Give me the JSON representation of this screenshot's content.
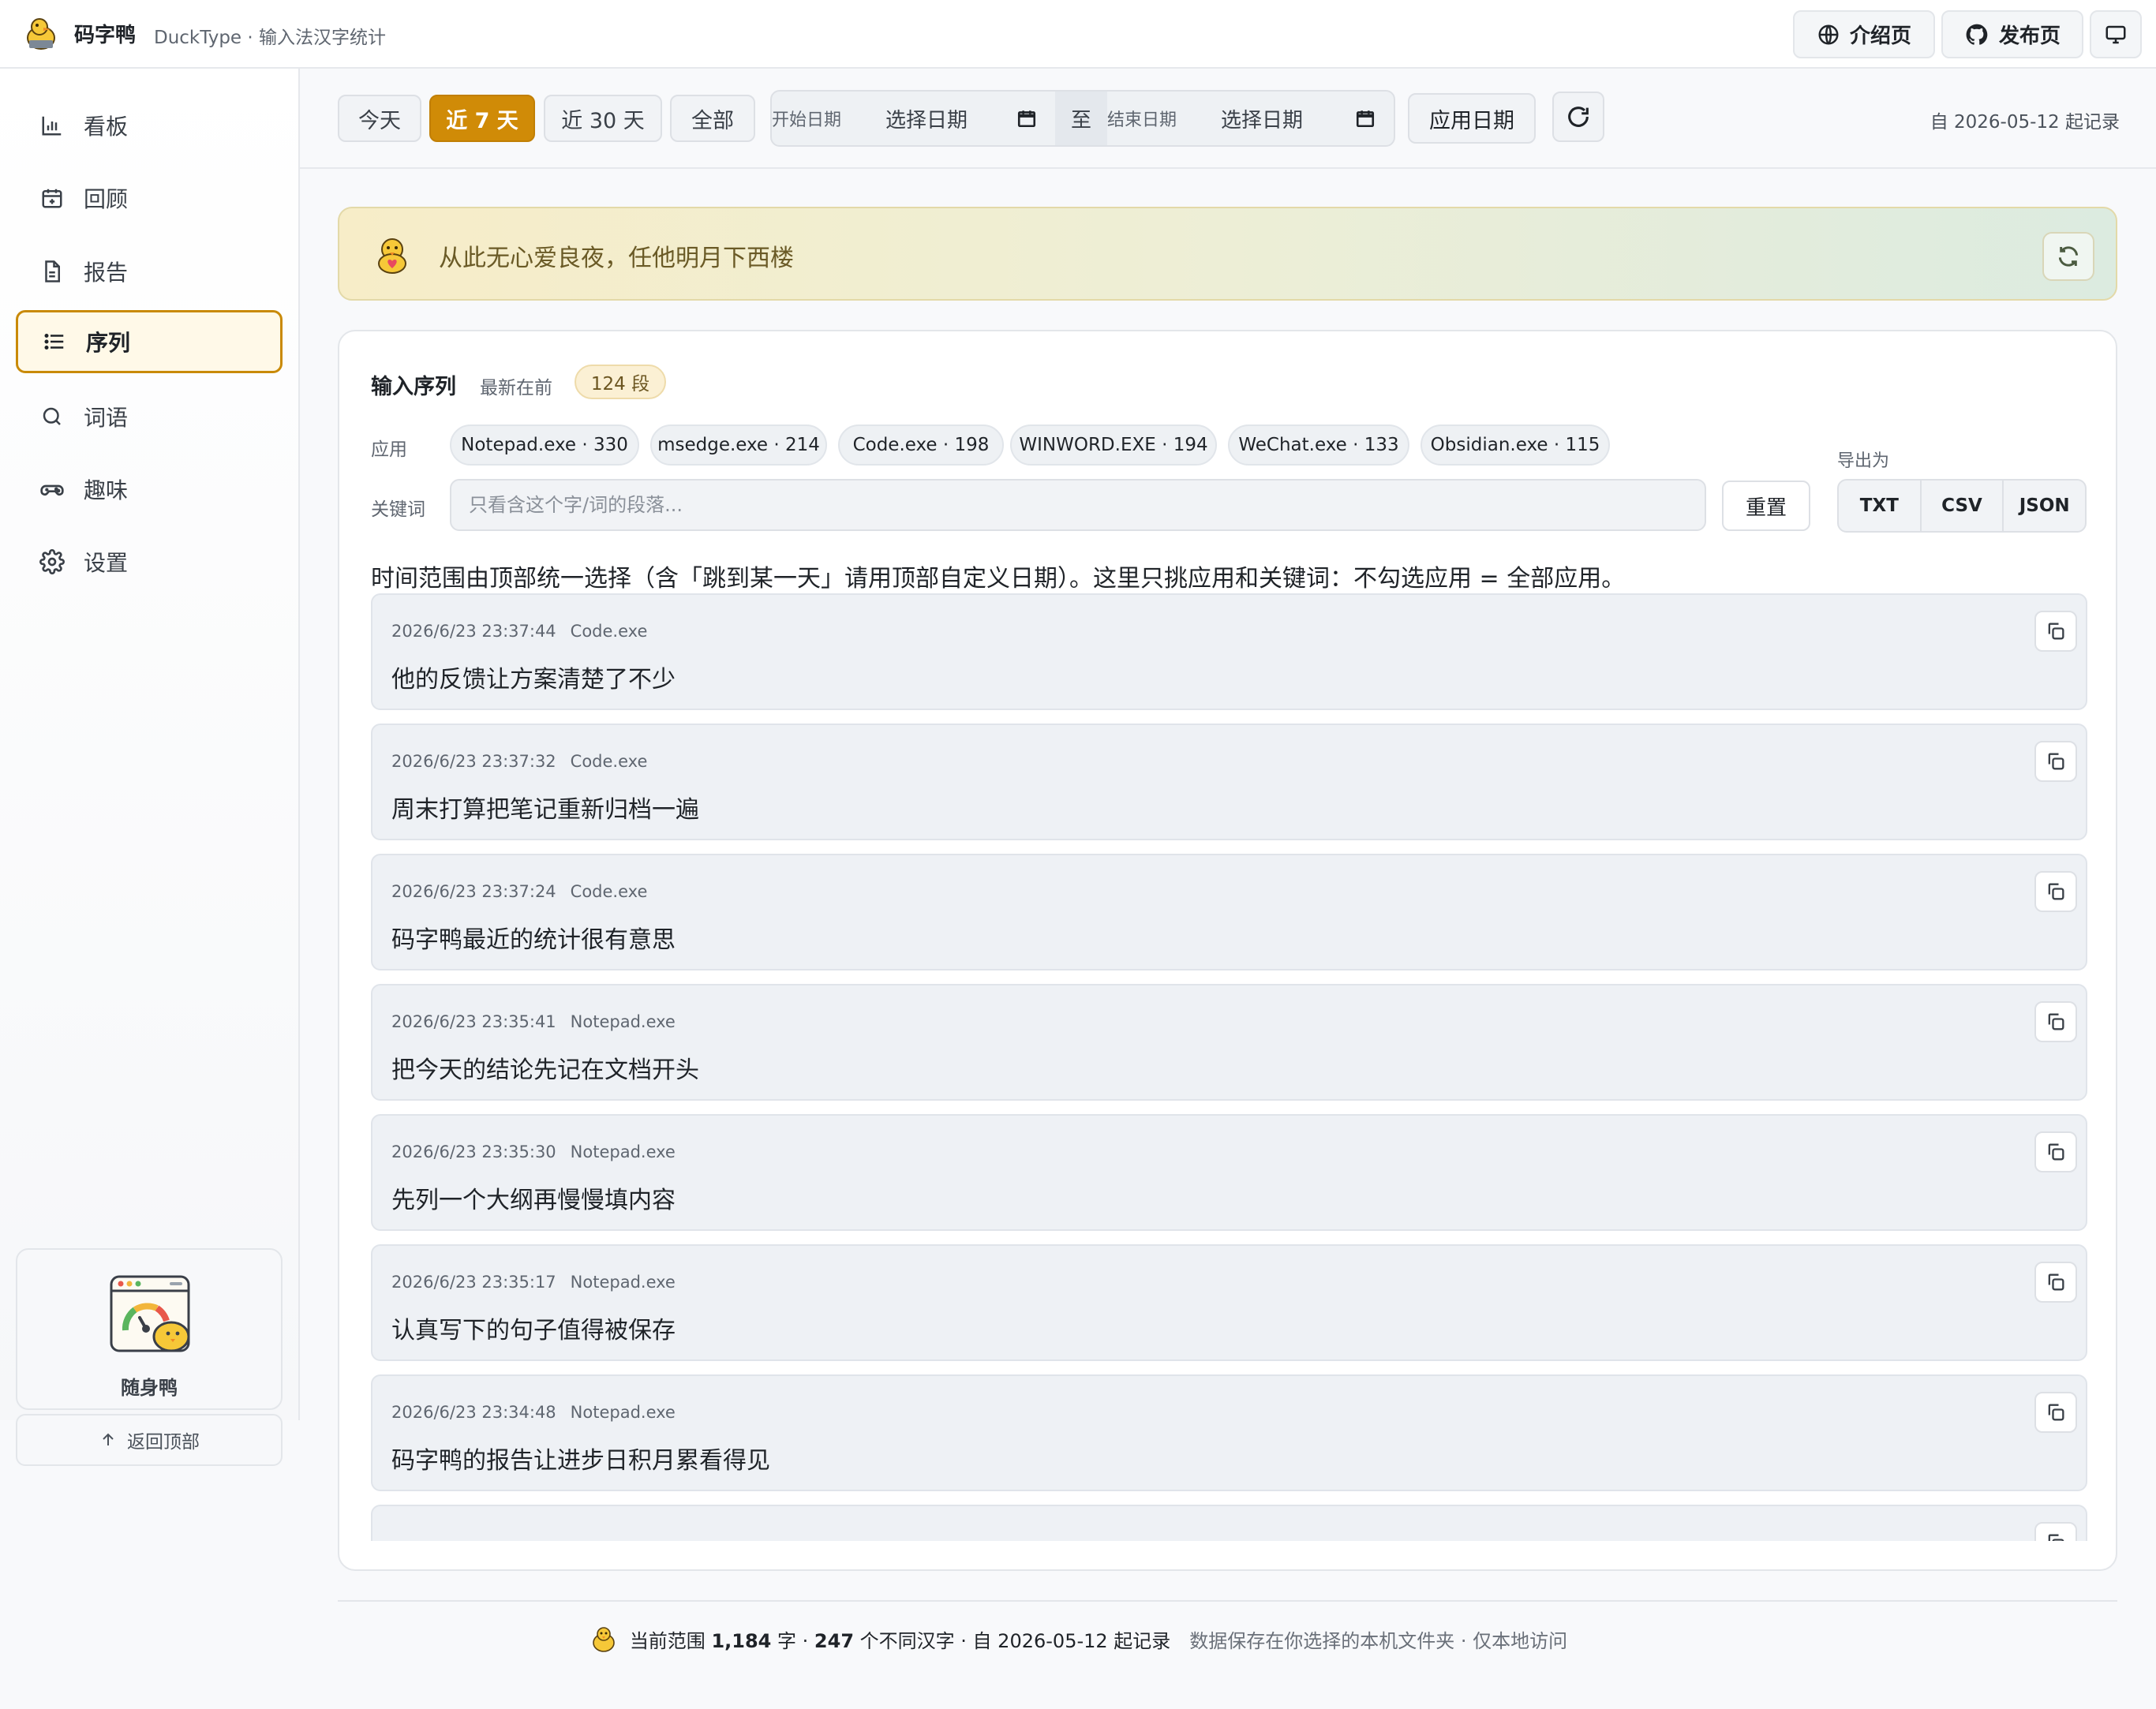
{
  "app": {
    "name": "码字鸭",
    "subtitle": "DuckType · 输入法汉字统计",
    "buttons": {
      "intro": "介绍页",
      "release": "发布页"
    }
  },
  "sidebar": {
    "items": [
      {
        "label": "看板",
        "icon": "bar-chart-icon"
      },
      {
        "label": "回顾",
        "icon": "calendar-plus-icon"
      },
      {
        "label": "报告",
        "icon": "document-icon"
      },
      {
        "label": "序列",
        "icon": "list-icon",
        "active": true
      },
      {
        "label": "词语",
        "icon": "search-icon"
      },
      {
        "label": "趣味",
        "icon": "gamepad-icon"
      },
      {
        "label": "设置",
        "icon": "gear-icon"
      }
    ],
    "pocket_label": "随身鸭",
    "back_to_top": "返回顶部"
  },
  "filters": {
    "ranges": [
      "今天",
      "近 7 天",
      "近 30 天",
      "全部"
    ],
    "active_range": "近 7 天",
    "start_caption": "开始日期",
    "start_value": "选择日期",
    "to_label": "至",
    "end_caption": "结束日期",
    "end_value": "选择日期",
    "apply": "应用日期",
    "since": "自 2026-05-12 起记录"
  },
  "banner": {
    "quote": "从此无心爱良夜，任他明月下西楼"
  },
  "sequence": {
    "title": "输入序列",
    "order": "最新在前",
    "count": "124 段",
    "app_label": "应用",
    "apps": [
      "Notepad.exe · 330",
      "msedge.exe · 214",
      "Code.exe · 198",
      "WINWORD.EXE · 194",
      "WeChat.exe · 133",
      "Obsidian.exe · 115"
    ],
    "keyword_label": "关键词",
    "keyword_placeholder": "只看含这个字/词的段落...",
    "reset": "重置",
    "export_label": "导出为",
    "export": [
      "TXT",
      "CSV",
      "JSON"
    ],
    "hint": "时间范围由顶部统一选择（含「跳到某一天」请用顶部自定义日期）。这里只挑应用和关键词：不勾选应用 = 全部应用。",
    "items": [
      {
        "time": "2026/6/23 23:37:44",
        "app": "Code.exe",
        "text": "他的反馈让方案清楚了不少"
      },
      {
        "time": "2026/6/23 23:37:32",
        "app": "Code.exe",
        "text": "周末打算把笔记重新归档一遍"
      },
      {
        "time": "2026/6/23 23:37:24",
        "app": "Code.exe",
        "text": "码字鸭最近的统计很有意思"
      },
      {
        "time": "2026/6/23 23:35:41",
        "app": "Notepad.exe",
        "text": "把今天的结论先记在文档开头"
      },
      {
        "time": "2026/6/23 23:35:30",
        "app": "Notepad.exe",
        "text": "先列一个大纲再慢慢填内容"
      },
      {
        "time": "2026/6/23 23:35:17",
        "app": "Notepad.exe",
        "text": "认真写下的句子值得被保存"
      },
      {
        "time": "2026/6/23 23:34:48",
        "app": "Notepad.exe",
        "text": "码字鸭的报告让进步日积月累看得见"
      }
    ]
  },
  "footer": {
    "prefix": "当前范围",
    "chars": "1,184",
    "chars_unit": "字 ·",
    "unique": "247",
    "unique_unit": "个不同汉字 · 自 2026-05-12 起记录",
    "note": "数据保存在你选择的本机文件夹 · 仅本地访问"
  },
  "colors": {
    "accent": "#d08b07",
    "banner_start": "#f7edc8",
    "banner_end": "#dcebe0"
  }
}
